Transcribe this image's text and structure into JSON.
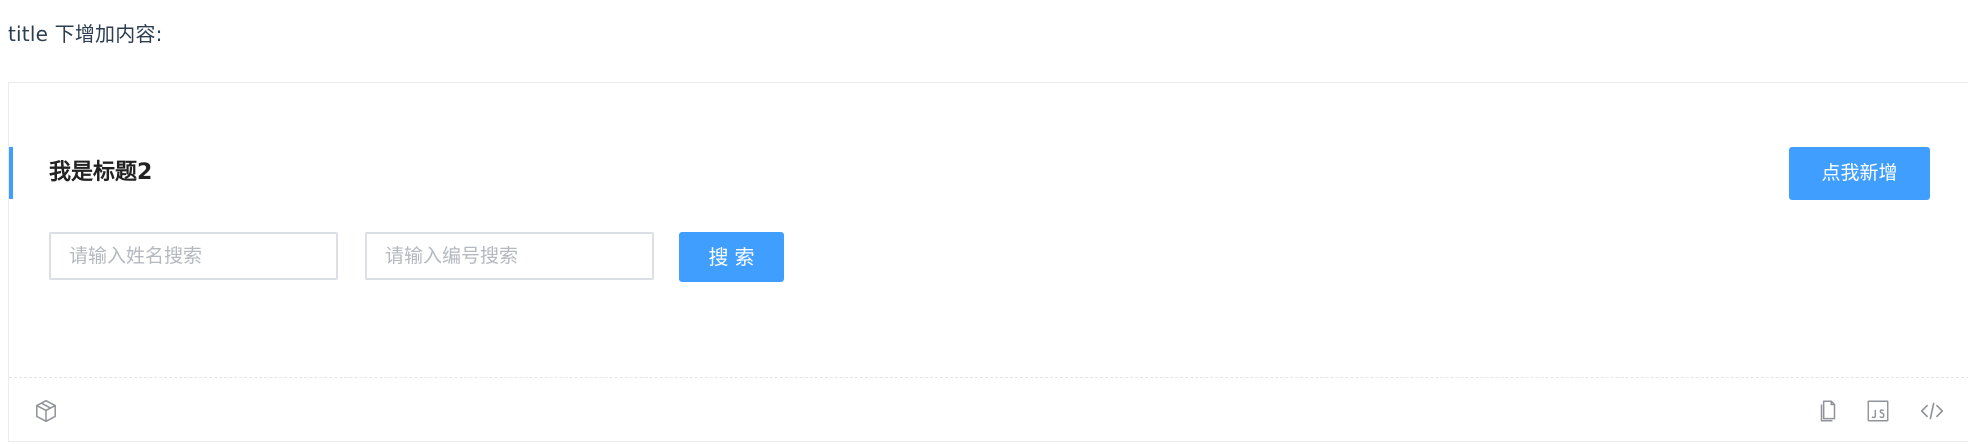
{
  "intro_text": "title 下增加内容:",
  "demo": {
    "title": "我是标题2",
    "add_button": "点我新增",
    "name_search_placeholder": "请输入姓名搜索",
    "code_search_placeholder": "请输入编号搜索",
    "search_button": "搜索"
  },
  "footer": {
    "icons": [
      "cube-icon",
      "copy-icon",
      "js-icon",
      "code-icon"
    ]
  },
  "colors": {
    "accent": "#409eff",
    "text": "#2c3e50",
    "border": "#dcdfe6"
  }
}
